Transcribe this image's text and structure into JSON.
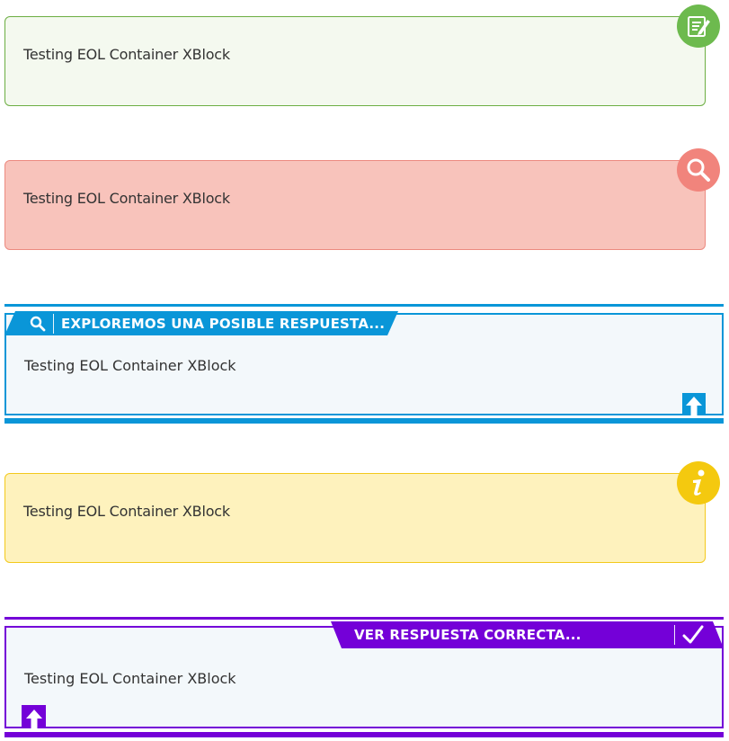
{
  "boxes": {
    "green": {
      "text": "Testing EOL Container XBlock",
      "icon": "notepad-pencil-icon",
      "color": "#6cae43"
    },
    "red": {
      "text": "Testing EOL Container XBlock",
      "icon": "magnifier-icon",
      "color": "#f1847c"
    },
    "blue": {
      "header": "EXPLOREMOS UNA POSIBLE RESPUESTA...",
      "text": "Testing EOL Container XBlock",
      "icon": "search-icon",
      "scroll_icon": "arrow-up-icon",
      "color": "#0a96d8"
    },
    "yellow": {
      "text": "Testing EOL Container XBlock",
      "icon": "info-icon",
      "color": "#f3c91c"
    },
    "purple": {
      "header": "VER RESPUESTA CORRECTA...",
      "text": "Testing EOL Container XBlock",
      "icon": "checkmark-icon",
      "scroll_icon": "arrow-up-icon",
      "color": "#7400d8"
    }
  }
}
